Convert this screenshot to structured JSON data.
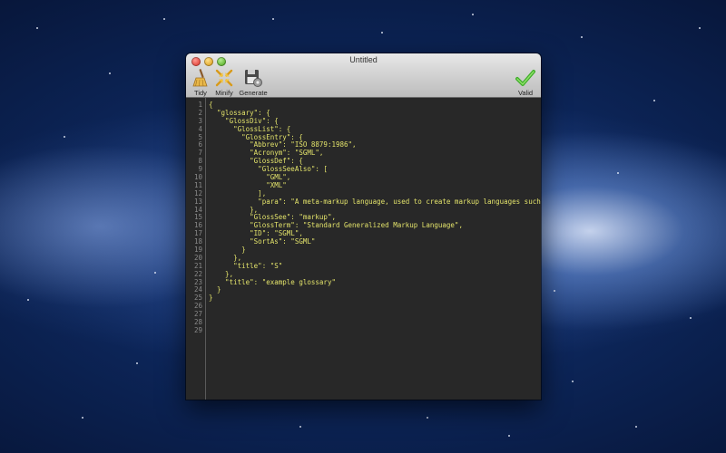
{
  "window": {
    "title": "Untitled"
  },
  "toolbar": {
    "tidy_label": "Tidy",
    "minify_label": "Minify",
    "generate_label": "Generate",
    "valid_label": "Valid"
  },
  "icons": {
    "tidy": "broom-icon",
    "minify": "compress-arrows-icon",
    "generate": "floppy-gear-icon",
    "valid": "checkmark-icon"
  },
  "colors": {
    "code_text": "#e2e26a",
    "editor_bg": "#282828",
    "line_number": "#8a8a8a",
    "valid_check": "#3fae2a"
  },
  "editor": {
    "line_numbers": [
      "1",
      "2",
      "3",
      "4",
      "5",
      "6",
      "7",
      "8",
      "9",
      "10",
      "11",
      "12",
      "13",
      "14",
      "15",
      "16",
      "17",
      "18",
      "19",
      "20",
      "21",
      "22",
      "23",
      "24",
      "25",
      "26",
      "27",
      "28",
      "29"
    ],
    "lines": [
      "{",
      "  \"glossary\": {",
      "    \"GlossDiv\": {",
      "      \"GlossList\": {",
      "        \"GlossEntry\": {",
      "          \"Abbrev\": \"ISO 8879:1986\",",
      "          \"Acronym\": \"SGML\",",
      "          \"GlossDef\": {",
      "            \"GlossSeeAlso\": [",
      "              \"GML\",",
      "              \"XML\"",
      "            ],",
      "            \"para\": \"A meta-markup language, used to create markup languages such as",
      "          },",
      "          \"GlossSee\": \"markup\",",
      "          \"GlossTerm\": \"Standard Generalized Markup Language\",",
      "          \"ID\": \"SGML\",",
      "          \"SortAs\": \"SGML\"",
      "        }",
      "      },",
      "      \"title\": \"S\"",
      "    },",
      "    \"title\": \"example glossary\"",
      "  }",
      "}",
      "",
      "",
      "",
      ""
    ]
  }
}
